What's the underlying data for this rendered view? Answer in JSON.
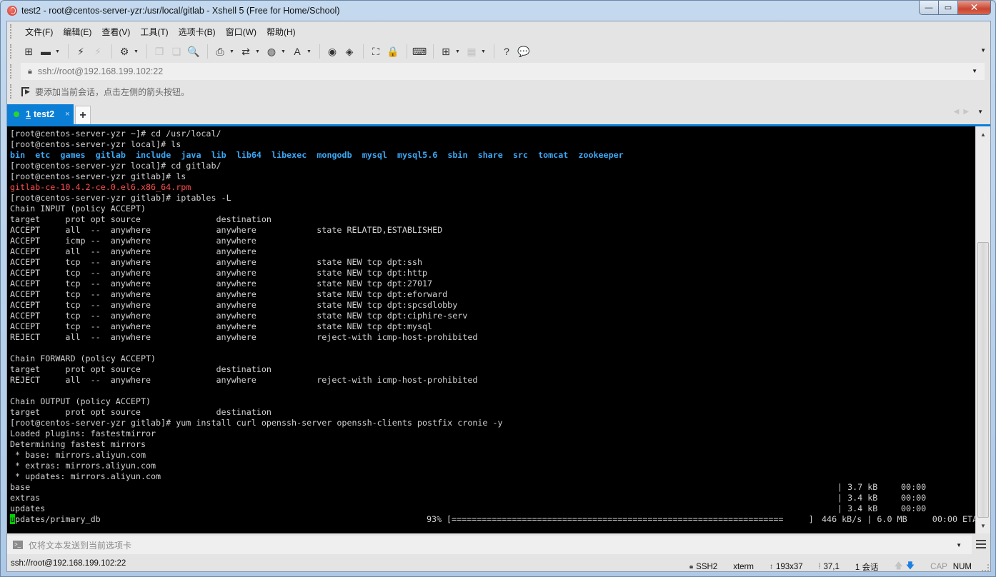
{
  "window": {
    "title": "test2 - root@centos-server-yzr:/usr/local/gitlab - Xshell 5 (Free for Home/School)",
    "controls": {
      "minimize": "—",
      "maximize": "▭",
      "close": "✕"
    }
  },
  "menubar": {
    "items": [
      "文件(F)",
      "编辑(E)",
      "查看(V)",
      "工具(T)",
      "选项卡(B)",
      "窗口(W)",
      "帮助(H)"
    ]
  },
  "toolbar": {
    "buttons": [
      {
        "name": "new-session-icon",
        "glyph": "⊞"
      },
      {
        "name": "open-folder-icon",
        "glyph": "▬",
        "dropdown": true
      },
      {
        "name": "connect-icon",
        "glyph": "⚡"
      },
      {
        "name": "disconnect-icon",
        "glyph": "⚡",
        "disabled": true
      },
      {
        "name": "session-properties-icon",
        "glyph": "⚙",
        "dropdown": true
      },
      {
        "name": "copy-icon",
        "glyph": "❐",
        "disabled": true
      },
      {
        "name": "paste-icon",
        "glyph": "❏",
        "disabled": true
      },
      {
        "name": "find-icon",
        "glyph": "🔍"
      },
      {
        "name": "print-icon",
        "glyph": "⎙",
        "dropdown": true
      },
      {
        "name": "transfer-icon",
        "glyph": "⇄",
        "dropdown": true
      },
      {
        "name": "globe-icon",
        "glyph": "◍",
        "dropdown": true
      },
      {
        "name": "font-icon",
        "glyph": "A",
        "dropdown": true
      },
      {
        "name": "xftp-icon",
        "glyph": "◉"
      },
      {
        "name": "xmanager-icon",
        "glyph": "◈"
      },
      {
        "name": "fullscreen-icon",
        "glyph": "⛶"
      },
      {
        "name": "lock-icon",
        "glyph": "🔒"
      },
      {
        "name": "keyboard-icon",
        "glyph": "⌨"
      },
      {
        "name": "new-tab-group-icon",
        "glyph": "⊞",
        "dropdown": true
      },
      {
        "name": "layout-icon",
        "glyph": "▦",
        "dropdown": true,
        "disabled": true
      },
      {
        "name": "help-icon",
        "glyph": "?"
      },
      {
        "name": "chat-icon",
        "glyph": "💬",
        "disabled": true
      }
    ]
  },
  "addressbar": {
    "value": "ssh://root@192.168.199.102:22"
  },
  "hintbar": {
    "text": "要添加当前会话，点击左侧的箭头按钮。"
  },
  "tabs": [
    {
      "number": "1",
      "label": "test2",
      "status_color": "#2bd42b",
      "close": "×"
    }
  ],
  "tab_add": "+",
  "terminal": {
    "lines": [
      {
        "text": "[root@centos-server-yzr ~]# cd /usr/local/"
      },
      {
        "text": "[root@centos-server-yzr local]# ls"
      },
      {
        "ls_dirs": [
          "bin",
          "etc",
          "games",
          "gitlab",
          "include",
          "java",
          "lib",
          "lib64",
          "libexec",
          "mongodb",
          "mysql",
          "mysql5.6",
          "sbin",
          "share",
          "src",
          "tomcat",
          "zookeeper"
        ]
      },
      {
        "text": "[root@centos-server-yzr local]# cd gitlab/"
      },
      {
        "text": "[root@centos-server-yzr gitlab]# ls"
      },
      {
        "text": "gitlab-ce-10.4.2-ce.0.el6.x86_64.rpm",
        "color": "red"
      },
      {
        "text": "[root@centos-server-yzr gitlab]# iptables -L"
      },
      {
        "text": "Chain INPUT (policy ACCEPT)"
      },
      {
        "text": "target     prot opt source               destination"
      },
      {
        "text": "ACCEPT     all  --  anywhere             anywhere            state RELATED,ESTABLISHED"
      },
      {
        "text": "ACCEPT     icmp --  anywhere             anywhere"
      },
      {
        "text": "ACCEPT     all  --  anywhere             anywhere"
      },
      {
        "text": "ACCEPT     tcp  --  anywhere             anywhere            state NEW tcp dpt:ssh"
      },
      {
        "text": "ACCEPT     tcp  --  anywhere             anywhere            state NEW tcp dpt:http"
      },
      {
        "text": "ACCEPT     tcp  --  anywhere             anywhere            state NEW tcp dpt:27017"
      },
      {
        "text": "ACCEPT     tcp  --  anywhere             anywhere            state NEW tcp dpt:eforward"
      },
      {
        "text": "ACCEPT     tcp  --  anywhere             anywhere            state NEW tcp dpt:spcsdlobby"
      },
      {
        "text": "ACCEPT     tcp  --  anywhere             anywhere            state NEW tcp dpt:ciphire-serv"
      },
      {
        "text": "ACCEPT     tcp  --  anywhere             anywhere            state NEW tcp dpt:mysql"
      },
      {
        "text": "REJECT     all  --  anywhere             anywhere            reject-with icmp-host-prohibited"
      },
      {
        "text": ""
      },
      {
        "text": "Chain FORWARD (policy ACCEPT)"
      },
      {
        "text": "target     prot opt source               destination"
      },
      {
        "text": "REJECT     all  --  anywhere             anywhere            reject-with icmp-host-prohibited"
      },
      {
        "text": ""
      },
      {
        "text": "Chain OUTPUT (policy ACCEPT)"
      },
      {
        "text": "target     prot opt source               destination"
      },
      {
        "text": "[root@centos-server-yzr gitlab]# yum install curl openssh-server openssh-clients postfix cronie -y"
      },
      {
        "text": "Loaded plugins: fastestmirror"
      },
      {
        "text": "Determining fastest mirrors"
      },
      {
        "text": " * base: mirrors.aliyun.com"
      },
      {
        "text": " * extras: mirrors.aliyun.com"
      },
      {
        "text": " * updates: mirrors.aliyun.com"
      },
      {
        "repo": "base",
        "size": "| 3.7 kB",
        "time": "00:00"
      },
      {
        "repo": "extras",
        "size": "| 3.4 kB",
        "time": "00:00"
      },
      {
        "repo": "updates",
        "size": "| 3.4 kB",
        "time": "00:00"
      },
      {
        "progress_line": true,
        "cursor_char": "u",
        "rest": "pdates/primary_db",
        "percent_text": "93%",
        "bar": "[==================================================================     ]",
        "stats": "446 kB/s | 6.0 MB     00:00 ETA"
      }
    ],
    "download_progress": 0.93
  },
  "sendbar": {
    "placeholder": "仅将文本发送到当前选项卡"
  },
  "statusbar": {
    "connection": "ssh://root@192.168.199.102:22",
    "protocol": "SSH2",
    "terminal_type": "xterm",
    "size": "193x37",
    "cursor_pos": "37,1",
    "sessions": "1 会话",
    "cap": "CAP",
    "num": "NUM"
  }
}
